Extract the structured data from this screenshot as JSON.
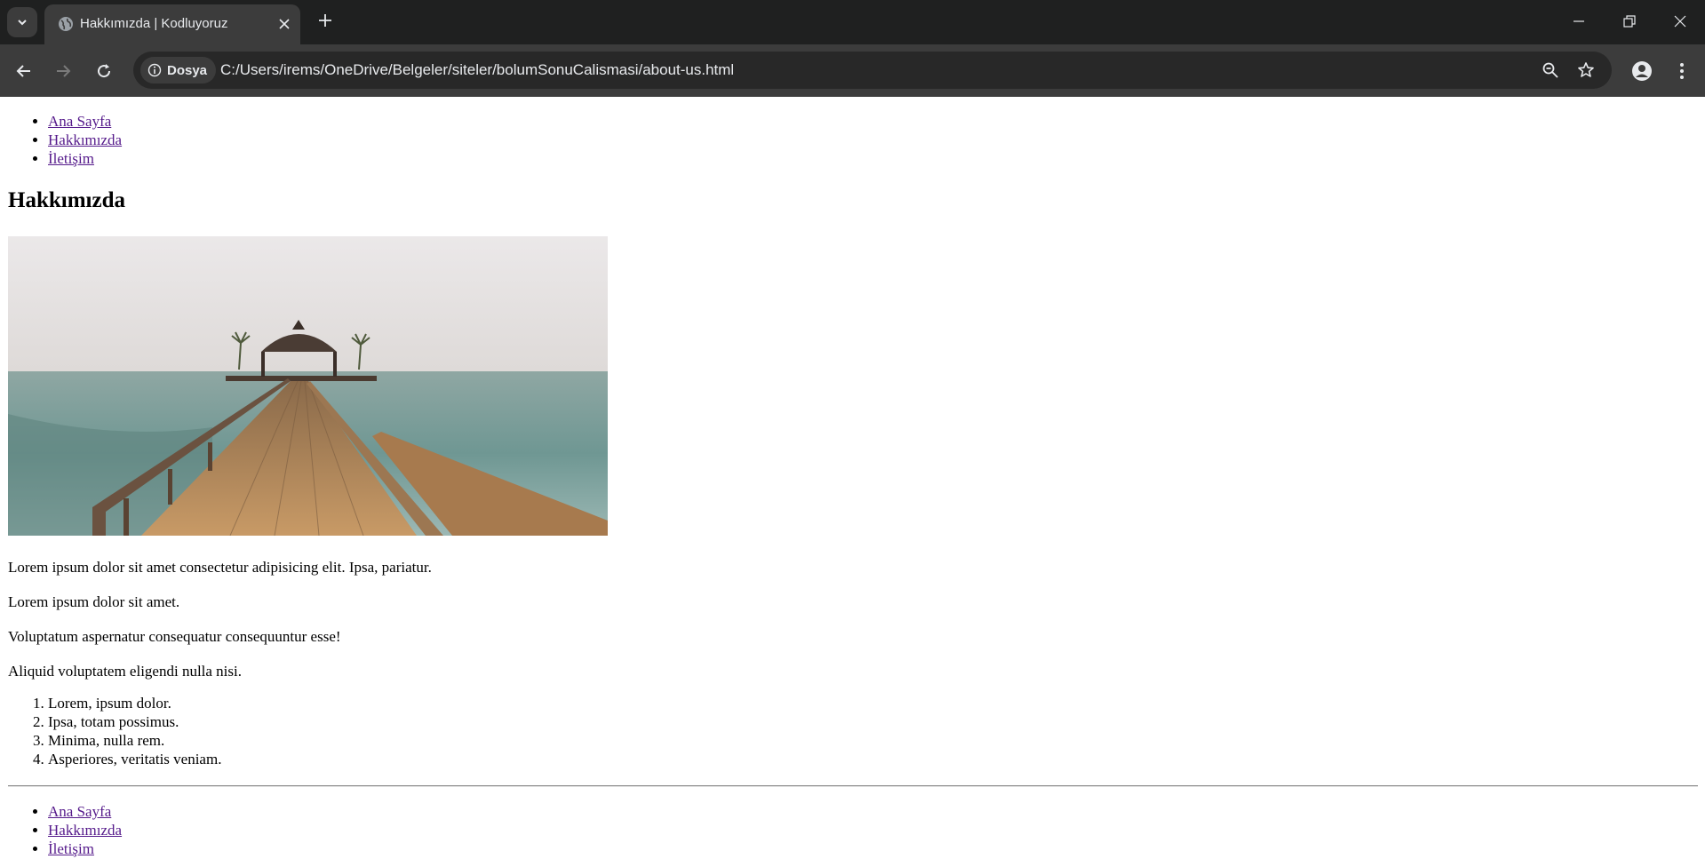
{
  "browser": {
    "tab_title": "Hakkımızda | Kodluyoruz",
    "security_chip": "Dosya",
    "url": "C:/Users/irems/OneDrive/Belgeler/siteler/bolumSonuCalismasi/about-us.html"
  },
  "page": {
    "nav_top": [
      "Ana Sayfa",
      "Hakkımızda",
      "İletişim"
    ],
    "heading": "Hakkımızda",
    "hero_image": "pier-over-sea-with-gazebo",
    "paragraphs": [
      "Lorem ipsum dolor sit amet consectetur adipisicing elit. Ipsa, pariatur.",
      "Lorem ipsum dolor sit amet.",
      "Voluptatum aspernatur consequatur consequuntur esse!",
      "Aliquid voluptatem eligendi nulla nisi."
    ],
    "ordered_list": [
      "Lorem, ipsum dolor.",
      "Ipsa, totam possimus.",
      "Minima, nulla rem.",
      "Asperiores, veritatis veniam."
    ],
    "nav_bottom": [
      "Ana Sayfa",
      "Hakkımızda",
      "İletişim"
    ]
  },
  "colors": {
    "chrome_bg": "#202124",
    "toolbar_bg": "#3c3c3c",
    "visited_link": "#551a8b"
  }
}
